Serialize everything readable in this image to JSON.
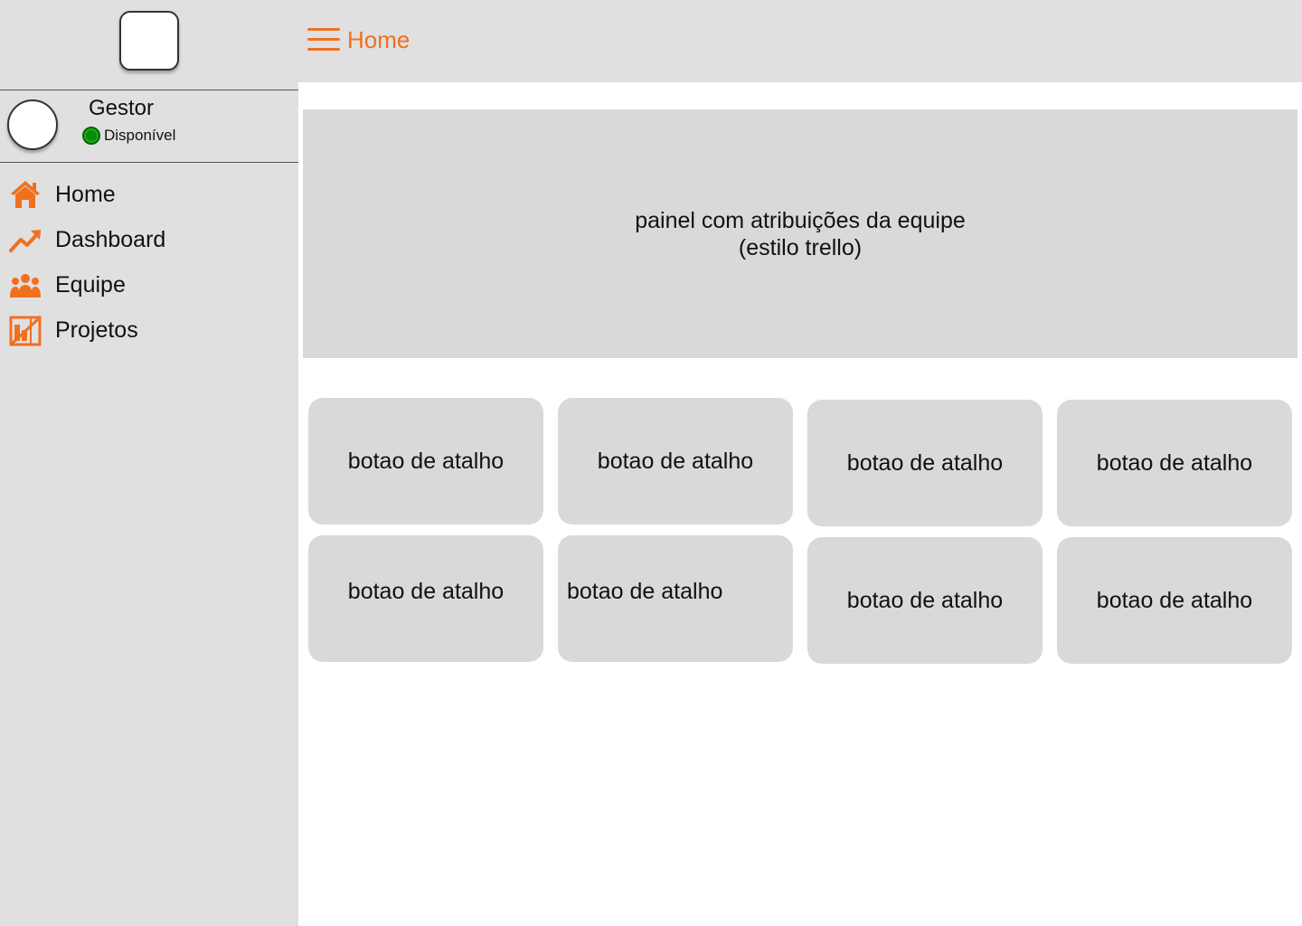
{
  "user": {
    "name": "Gestor",
    "status": "Disponível",
    "status_color": "#0a8a0a"
  },
  "accent_color": "#f07020",
  "sidebar": {
    "items": [
      {
        "label": "Home",
        "icon": "home-icon"
      },
      {
        "label": "Dashboard",
        "icon": "trending-up-icon"
      },
      {
        "label": "Equipe",
        "icon": "team-icon"
      },
      {
        "label": "Projetos",
        "icon": "projects-icon"
      }
    ]
  },
  "header": {
    "title": "Home",
    "menu_icon": "hamburger-menu-icon"
  },
  "main": {
    "panel": {
      "line1": "painel com atribuições da equipe",
      "line2": "(estilo trello)"
    },
    "shortcuts": [
      "botao de atalho",
      "botao de atalho",
      "botao de atalho",
      "botao de atalho",
      "botao de atalho",
      "botao de atalho",
      "botao de atalho",
      "botao de atalho"
    ]
  }
}
